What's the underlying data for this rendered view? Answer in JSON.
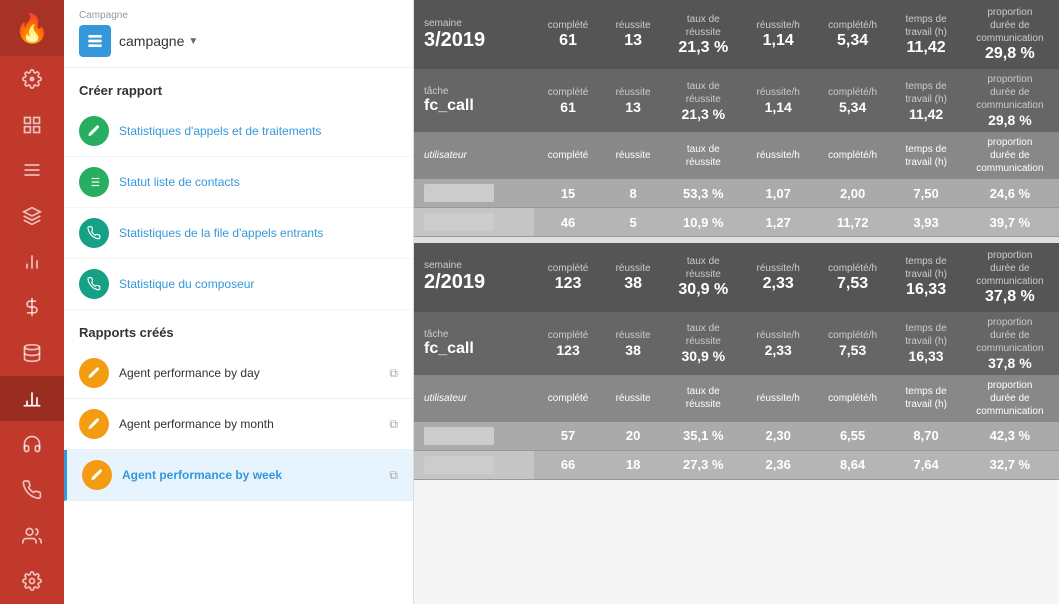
{
  "iconBar": {
    "items": [
      {
        "name": "logo",
        "icon": "🔥"
      },
      {
        "name": "home",
        "icon": "⚙"
      },
      {
        "name": "grid",
        "icon": "⊞"
      },
      {
        "name": "layers",
        "icon": "≡"
      },
      {
        "name": "stack",
        "icon": "◫"
      },
      {
        "name": "chart",
        "icon": "📊"
      },
      {
        "name": "dollar",
        "icon": "💲"
      },
      {
        "name": "database",
        "icon": "🗄"
      },
      {
        "name": "bar-active",
        "icon": "📈"
      },
      {
        "name": "headset",
        "icon": "🎧"
      },
      {
        "name": "phone",
        "icon": "📞"
      },
      {
        "name": "contacts",
        "icon": "👥"
      },
      {
        "name": "settings2",
        "icon": "⚙"
      }
    ]
  },
  "sidebar": {
    "campaign": {
      "label": "Campagne",
      "value": "campagne"
    },
    "createReport": {
      "title": "Créer rapport",
      "items": [
        {
          "label": "Statistiques d'appels et de traitements",
          "icon": "✎",
          "color": "green"
        },
        {
          "label": "Statut liste de contacts",
          "icon": "≡",
          "color": "green"
        },
        {
          "label": "Statistiques de la file d'appels entrants",
          "icon": "📞",
          "color": "teal"
        },
        {
          "label": "Statistique du composeur",
          "icon": "📞",
          "color": "teal"
        }
      ]
    },
    "createdReports": {
      "title": "Rapports créés",
      "items": [
        {
          "label": "Agent performance by day",
          "active": false
        },
        {
          "label": "Agent performance by month",
          "active": false
        },
        {
          "label": "Agent performance by week",
          "active": true
        }
      ]
    }
  },
  "table": {
    "columns": {
      "complété": "complété",
      "réussite": "réussite",
      "tauxRéussite": "taux de réussite",
      "réussiteH": "réussite/h",
      "complétéH": "complété/h",
      "tempsTravail": "temps de travail (h)",
      "proportionDurée": "proportion durée de communication"
    },
    "week1": {
      "label": "semaine",
      "value": "3/2019",
      "complété": "61",
      "réussite": "13",
      "tauxRéussite": "21,3 %",
      "réussiteH": "1,14",
      "complétéH": "5,34",
      "tempsTravail": "11,42",
      "proportionDurée": "29,8 %"
    },
    "week1task": {
      "label": "tâche",
      "value": "fc_call",
      "complété": "61",
      "réussite": "13",
      "tauxRéussite": "21,3 %",
      "réussiteH": "1,14",
      "complétéH": "5,34",
      "tempsTravail": "11,42",
      "proportionDurée": "29,8 %"
    },
    "week1users": [
      {
        "complété": "15",
        "réussite": "8",
        "tauxRéussite": "53,3 %",
        "réussiteH": "1,07",
        "complétéH": "2,00",
        "tempsTravail": "7,50",
        "proportionDurée": "24,6 %"
      },
      {
        "complété": "46",
        "réussite": "5",
        "tauxRéussite": "10,9 %",
        "réussiteH": "1,27",
        "complétéH": "11,72",
        "tempsTravail": "3,93",
        "proportionDurée": "39,7 %"
      }
    ],
    "week2": {
      "label": "semaine",
      "value": "2/2019",
      "complété": "123",
      "réussite": "38",
      "tauxRéussite": "30,9 %",
      "réussiteH": "2,33",
      "complétéH": "7,53",
      "tempsTravail": "16,33",
      "proportionDurée": "37,8 %"
    },
    "week2task": {
      "label": "tâche",
      "value": "fc_call",
      "complété": "123",
      "réussite": "38",
      "tauxRéussite": "30,9 %",
      "réussiteH": "2,33",
      "complétéH": "7,53",
      "tempsTravail": "16,33",
      "proportionDurée": "37,8 %"
    },
    "week2users": [
      {
        "complété": "57",
        "réussite": "20",
        "tauxRéussite": "35,1 %",
        "réussiteH": "2,30",
        "complétéH": "6,55",
        "tempsTravail": "8,70",
        "proportionDurée": "42,3 %"
      },
      {
        "complété": "66",
        "réussite": "18",
        "tauxRéussite": "27,3 %",
        "réussiteH": "2,36",
        "complétéH": "8,64",
        "tempsTravail": "7,64",
        "proportionDurée": "32,7 %"
      }
    ]
  }
}
